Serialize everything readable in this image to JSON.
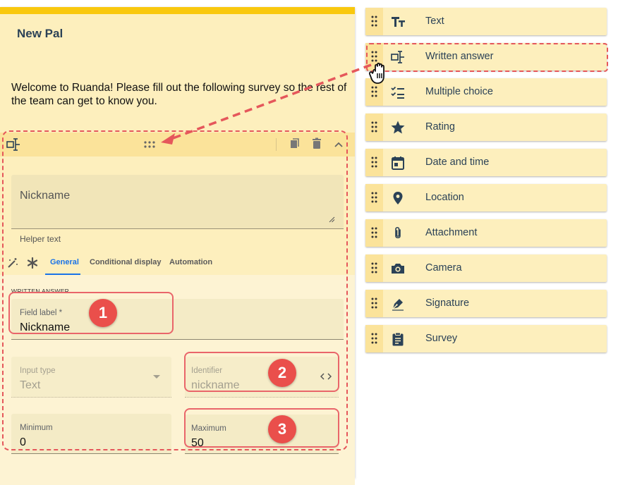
{
  "form": {
    "title": "New Pal",
    "description": "Welcome to Ruanda! Please fill out the following survey so the rest of the team can get to know you.",
    "block": {
      "question_placeholder": "Nickname",
      "helper_text": "Helper text",
      "tabs": [
        {
          "label": "General",
          "active": true
        },
        {
          "label": "Conditional display",
          "active": false
        },
        {
          "label": "Automation",
          "active": false
        }
      ],
      "section_title": "WRITTEN ANSWER",
      "field_label": {
        "label": "Field label *",
        "value": "Nickname"
      },
      "input_type": {
        "label": "Input type",
        "value": "Text"
      },
      "identifier": {
        "label": "Identifier",
        "value": "nickname"
      },
      "minimum": {
        "label": "Minimum",
        "value": "0"
      },
      "maximum": {
        "label": "Maximum",
        "value": "50"
      }
    },
    "badges": [
      "1",
      "2",
      "3"
    ]
  },
  "palette": {
    "items": [
      {
        "label": "Text",
        "icon": "text-format-icon"
      },
      {
        "label": "Written answer",
        "icon": "text-input-icon"
      },
      {
        "label": "Multiple choice",
        "icon": "checklist-icon"
      },
      {
        "label": "Rating",
        "icon": "star-icon"
      },
      {
        "label": "Date and time",
        "icon": "calendar-icon"
      },
      {
        "label": "Location",
        "icon": "location-pin-icon"
      },
      {
        "label": "Attachment",
        "icon": "paperclip-icon"
      },
      {
        "label": "Camera",
        "icon": "camera-icon"
      },
      {
        "label": "Signature",
        "icon": "pen-icon"
      },
      {
        "label": "Survey",
        "icon": "clipboard-icon"
      }
    ]
  },
  "colors": {
    "accent_yellow": "#f9c80e",
    "panel": "#fdefbd",
    "highlight_red": "#ea4f4b",
    "tab_blue": "#1a73e8",
    "icon_navy": "#2b4257"
  }
}
